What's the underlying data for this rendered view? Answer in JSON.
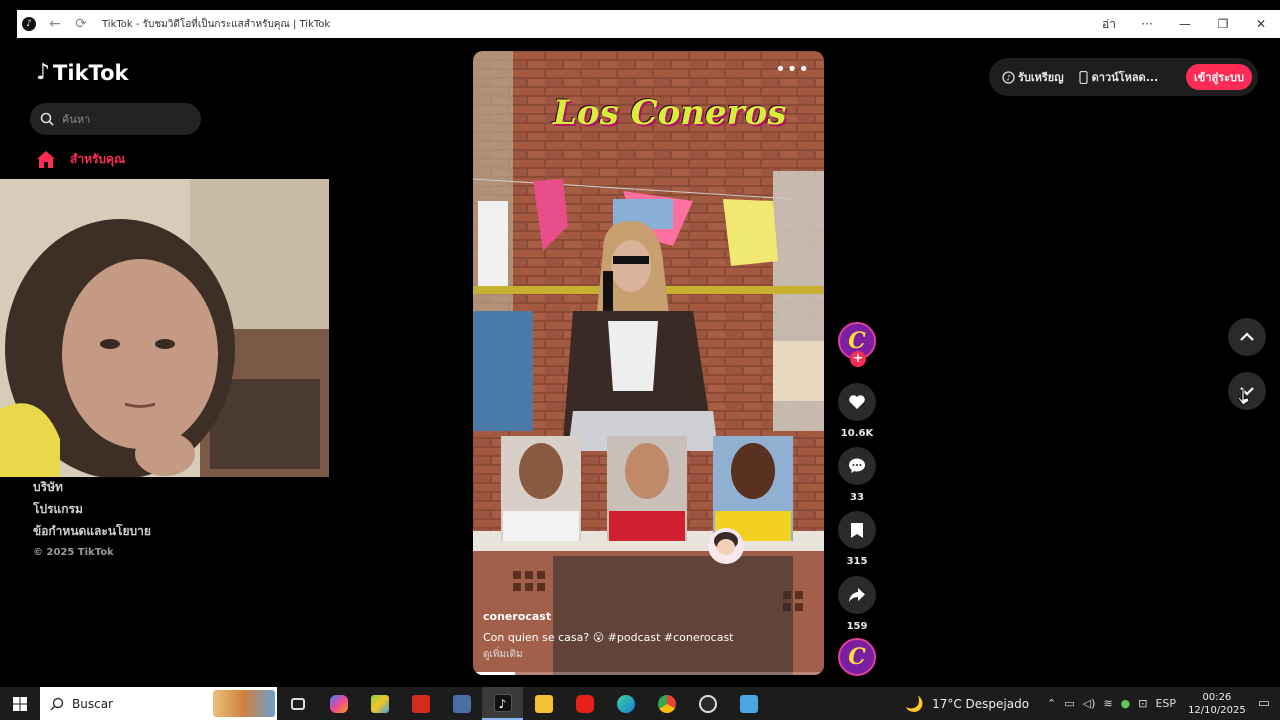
{
  "window": {
    "title": "TikTok - รับชมวิดีโอที่เป็นกระแสสำหรับคุณ | TikTok",
    "extra_label": "อ่า"
  },
  "sidebar": {
    "logo_text": "TikTok",
    "search_placeholder": "ค้นหา",
    "nav_for_you": "สำหรับคุณ",
    "footer": [
      "บริษัท",
      "โปรแกรม",
      "ข้อกำหนดและนโยบาย"
    ],
    "copyright": "© 2025 TikTok"
  },
  "header": {
    "coins_label": "รับเหรียญ",
    "download_label": "ดาวน์โหลด...",
    "login_label": "เข้าสู่ระบบ"
  },
  "video": {
    "show_logo": "Los Coneros",
    "author": "conerocast",
    "caption": "Con quien se casa? 😮 #podcast  #conerocast",
    "caption_more": "ดูเพิ่มเติม",
    "progress": 0.12
  },
  "actions": {
    "likes": "10.6K",
    "comments": "33",
    "saves": "315",
    "shares": "159"
  },
  "taskbar": {
    "search_label": "Buscar",
    "weather": "17°C  Despejado",
    "lang": "ESP",
    "time": "00:26",
    "date": "12/10/2025"
  },
  "colors": {
    "accent": "#fe2c55",
    "background": "#000000",
    "surface": "#2a2a2a"
  }
}
